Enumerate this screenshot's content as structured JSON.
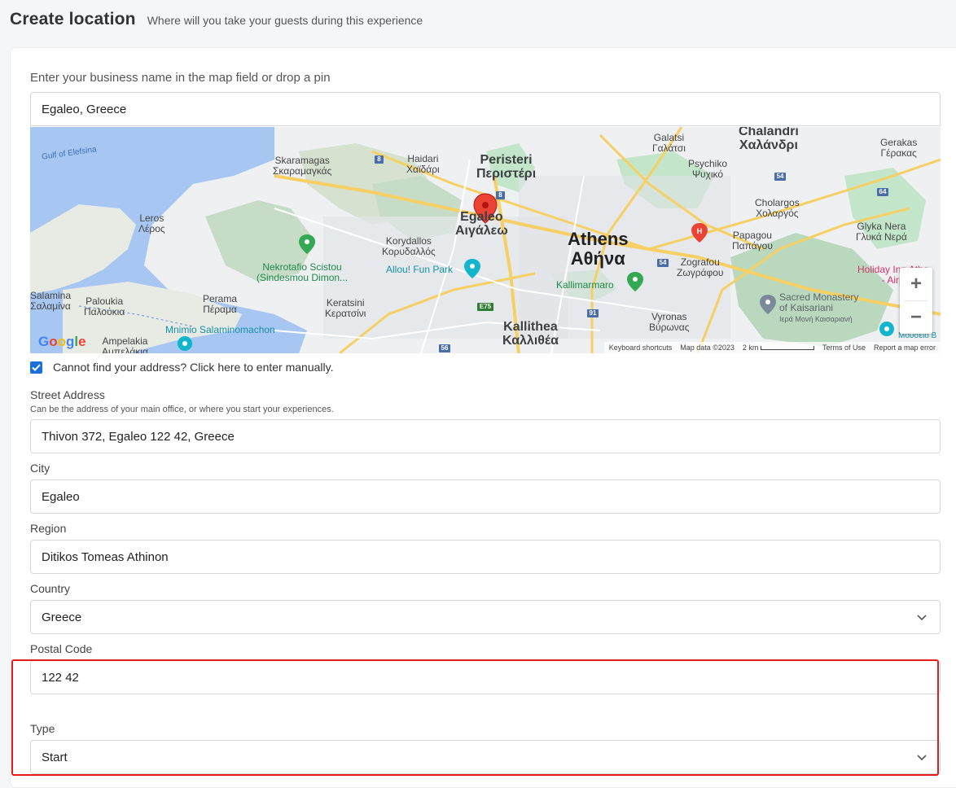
{
  "header": {
    "title": "Create location",
    "subtitle": "Where will you take your guests during this experience"
  },
  "form": {
    "hint": "Enter your business name in the map field or drop a pin",
    "search_value": "Egaleo, Greece",
    "manual_checkbox": {
      "label": "Cannot find your address? Click here to enter manually.",
      "checked": true
    },
    "street": {
      "label": "Street Address",
      "help": "Can be the address of your main office, or where you start your experiences.",
      "value": "Thivon 372, Egaleo 122 42, Greece"
    },
    "city": {
      "label": "City",
      "value": "Egaleo"
    },
    "region": {
      "label": "Region",
      "value": "Ditikos Tomeas Athinon"
    },
    "country": {
      "label": "Country",
      "value": "Greece"
    },
    "postal": {
      "label": "Postal Code",
      "value": "122 42"
    },
    "type": {
      "label": "Type",
      "value": "Start"
    }
  },
  "map": {
    "labels": {
      "gulf": "Gulf of Elefsina",
      "skaramagas": "Skaramagas",
      "skaramagas_gr": "Σκαραμαγκάς",
      "haidari": "Haidari",
      "haidari_gr": "Χαϊδάρι",
      "peristeri": "Peristeri",
      "peristeri_gr": "Περιστέρι",
      "galatsi": "Galatsi",
      "galatsi_gr": "Γαλάτσι",
      "chalandri": "Chalandri",
      "chalandri_gr": "Χαλάνδρι",
      "gerakas": "Gerakas",
      "gerakas_gr": "Γέρακας",
      "psychiko": "Psychiko",
      "psychiko_gr": "Ψυχικό",
      "leros": "Leros",
      "leros_gr": "Λέρος",
      "egaleo": "Egaleo",
      "egaleo_gr": "Αιγάλεω",
      "athens": "Athens",
      "athens_gr": "Αθήνα",
      "cholargos": "Cholargos",
      "cholargos_gr": "Χολαργός",
      "papagou": "Papagou",
      "papagou_gr": "Παπάγου",
      "glyka": "Glyka Nera",
      "glyka_gr": "Γλυκά Νερά",
      "korydallos": "Korydallos",
      "korydallos_gr": "Κορυδαλλός",
      "nekrotafio": "Nekrotafio Scistou",
      "nekrotafio2": "(Sindesmou Dimon...",
      "allou": "Allou! Fun Park",
      "zografou": "Zografou",
      "zografou_gr": "Ζωγράφου",
      "holiday": "Holiday Inn Athe",
      "airport": "- Airp",
      "kallimarmaro": "Kallimarmaro",
      "salamina": "Salamina",
      "salamina_gr": "Σαλαμίνα",
      "paloukia": "Paloukia",
      "paloukia_gr": "Παλούκια",
      "perama": "Perama",
      "perama_gr": "Πέραμα",
      "keratsini": "Keratsini",
      "keratsini_gr": "Κερατσίνι",
      "sacred": "Sacred Monastery",
      "sacred2": "of Kaisariani",
      "sacred_gr": "Ιερά Μονή Καισαριανή",
      "vyronas": "Vyronas",
      "vyronas_gr": "Βύρωνας",
      "kallithea": "Kallithea",
      "kallithea_gr": "Καλλιθέα",
      "ampelakia": "Ampelakia",
      "ampelakia_gr": "Αμπελάκια",
      "mnimio": "Mnimio Salaminomachon",
      "mouseio": "Μουσείο Β"
    },
    "road_badges": [
      "8",
      "8",
      "54",
      "64",
      "54",
      "E75",
      "91",
      "56"
    ],
    "attribution": {
      "keyboard": "Keyboard shortcuts",
      "mapdata": "Map data ©2023",
      "scale": "2 km",
      "terms": "Terms of Use",
      "report": "Report a map error"
    },
    "logo": "Google",
    "zoom_in": "+",
    "zoom_out": "−"
  },
  "colors": {
    "accent": "#1a6fd8",
    "highlight": "#e31b1b",
    "water": "#a7c7f2",
    "park": "#c3e6cb",
    "road": "#f6cf65",
    "pin": "#ea4335"
  }
}
